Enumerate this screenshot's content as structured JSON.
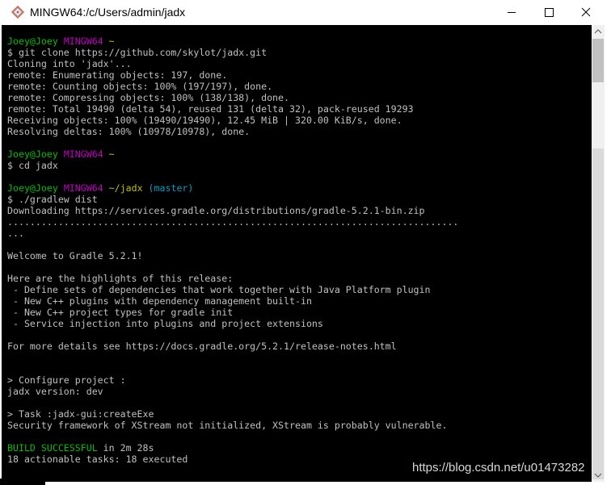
{
  "window": {
    "title": "MINGW64:/c/Users/admin/jadx"
  },
  "terminal": {
    "lines": [
      [
        {
          "t": "Joey@Joey ",
          "c": "c-green"
        },
        {
          "t": "MINGW64",
          "c": "c-magenta"
        },
        {
          "t": " ",
          "c": "c-default"
        },
        {
          "t": "~",
          "c": "c-yellow"
        }
      ],
      [
        {
          "t": "$ git clone https://github.com/skylot/jadx.git",
          "c": "c-default"
        }
      ],
      [
        {
          "t": "Cloning into 'jadx'...",
          "c": "c-default"
        }
      ],
      [
        {
          "t": "remote: Enumerating objects: 197, done.",
          "c": "c-default"
        }
      ],
      [
        {
          "t": "remote: Counting objects: 100% (197/197), done.",
          "c": "c-default"
        }
      ],
      [
        {
          "t": "remote: Compressing objects: 100% (138/138), done.",
          "c": "c-default"
        }
      ],
      [
        {
          "t": "remote: Total 19490 (delta 54), reused 131 (delta 32), pack-reused 19293",
          "c": "c-default"
        }
      ],
      [
        {
          "t": "Receiving objects: 100% (19490/19490), 12.45 MiB | 320.00 KiB/s, done.",
          "c": "c-default"
        }
      ],
      [
        {
          "t": "Resolving deltas: 100% (10978/10978), done.",
          "c": "c-default"
        }
      ],
      [
        {
          "t": "",
          "c": "c-default"
        }
      ],
      [
        {
          "t": "Joey@Joey ",
          "c": "c-green"
        },
        {
          "t": "MINGW64",
          "c": "c-magenta"
        },
        {
          "t": " ",
          "c": "c-default"
        },
        {
          "t": "~",
          "c": "c-yellow"
        }
      ],
      [
        {
          "t": "$ cd jadx",
          "c": "c-default"
        }
      ],
      [
        {
          "t": "",
          "c": "c-default"
        }
      ],
      [
        {
          "t": "Joey@Joey ",
          "c": "c-green"
        },
        {
          "t": "MINGW64",
          "c": "c-magenta"
        },
        {
          "t": " ",
          "c": "c-default"
        },
        {
          "t": "~/jadx",
          "c": "c-yellow"
        },
        {
          "t": " (master)",
          "c": "c-cyan"
        }
      ],
      [
        {
          "t": "$ ./gradlew dist",
          "c": "c-default"
        }
      ],
      [
        {
          "t": "Downloading https://services.gradle.org/distributions/gradle-5.2.1-bin.zip",
          "c": "c-default"
        }
      ],
      [
        {
          "t": "................................................................................",
          "c": "c-default"
        }
      ],
      [
        {
          "t": "...",
          "c": "c-default"
        }
      ],
      [
        {
          "t": "",
          "c": "c-default"
        }
      ],
      [
        {
          "t": "Welcome to Gradle 5.2.1!",
          "c": "c-default"
        }
      ],
      [
        {
          "t": "",
          "c": "c-default"
        }
      ],
      [
        {
          "t": "Here are the highlights of this release:",
          "c": "c-default"
        }
      ],
      [
        {
          "t": " - Define sets of dependencies that work together with Java Platform plugin",
          "c": "c-default"
        }
      ],
      [
        {
          "t": " - New C++ plugins with dependency management built-in",
          "c": "c-default"
        }
      ],
      [
        {
          "t": " - New C++ project types for gradle init",
          "c": "c-default"
        }
      ],
      [
        {
          "t": " - Service injection into plugins and project extensions",
          "c": "c-default"
        }
      ],
      [
        {
          "t": "",
          "c": "c-default"
        }
      ],
      [
        {
          "t": "For more details see https://docs.gradle.org/5.2.1/release-notes.html",
          "c": "c-default"
        }
      ],
      [
        {
          "t": "",
          "c": "c-default"
        }
      ],
      [
        {
          "t": "",
          "c": "c-default"
        }
      ],
      [
        {
          "t": "> Configure project :",
          "c": "c-default"
        }
      ],
      [
        {
          "t": "jadx version: dev",
          "c": "c-default"
        }
      ],
      [
        {
          "t": "",
          "c": "c-default"
        }
      ],
      [
        {
          "t": "> Task :jadx-gui:createExe",
          "c": "c-default"
        }
      ],
      [
        {
          "t": "Security framework of XStream not initialized, XStream is probably vulnerable.",
          "c": "c-default"
        }
      ],
      [
        {
          "t": "",
          "c": "c-default"
        }
      ],
      [
        {
          "t": "BUILD SUCCESSFUL",
          "c": "c-green"
        },
        {
          "t": " in 2m 28s",
          "c": "c-default"
        }
      ],
      [
        {
          "t": "18 actionable tasks: 18 executed",
          "c": "c-default"
        }
      ]
    ]
  },
  "watermark": "https://blog.csdn.net/u01473282",
  "colors": {
    "terminal_bg": "#000000",
    "text_default": "#c0c0c0",
    "prompt_user": "#00c000",
    "prompt_system": "#c000c0",
    "prompt_path": "#c0c000",
    "git_branch": "#00a0c0",
    "build_success": "#00c000"
  },
  "icons": {
    "app": "git-bash-icon",
    "minimize": "minimize-icon",
    "maximize": "maximize-icon",
    "close": "close-icon"
  }
}
